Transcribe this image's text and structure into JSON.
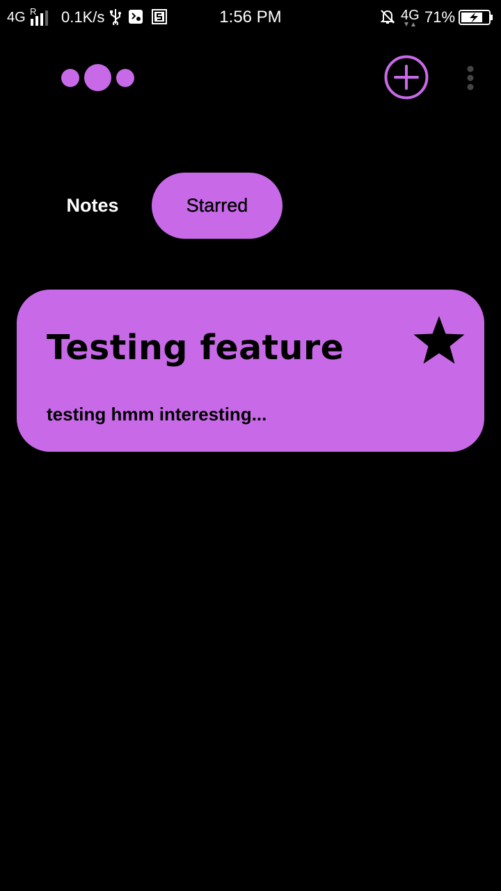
{
  "status_bar": {
    "network_left": "4G",
    "roaming": "R",
    "speed": "0.1K/s",
    "time": "1:56 PM",
    "network_right": "4G",
    "battery_percent": "71%",
    "icons": [
      "signal-icon",
      "usb-icon",
      "debug-icon",
      "s-app-icon",
      "bell-off-icon",
      "data-arrows-icon",
      "battery-charging-icon"
    ]
  },
  "header": {
    "logo_icon": "three-dots-logo",
    "add_icon": "plus-circle-icon",
    "menu_icon": "vertical-dots-menu-icon"
  },
  "tabs": [
    {
      "label": "Notes",
      "active": false
    },
    {
      "label": "Starred",
      "active": true
    }
  ],
  "notes": [
    {
      "title": "Testing feature",
      "preview": "testing hmm interesting...",
      "starred": true,
      "star_icon": "star-filled-icon"
    }
  ],
  "colors": {
    "background": "#000000",
    "accent": "#c86ae8",
    "text_light": "#ffffff",
    "text_dark": "#000000",
    "menu_dots": "#444444"
  }
}
